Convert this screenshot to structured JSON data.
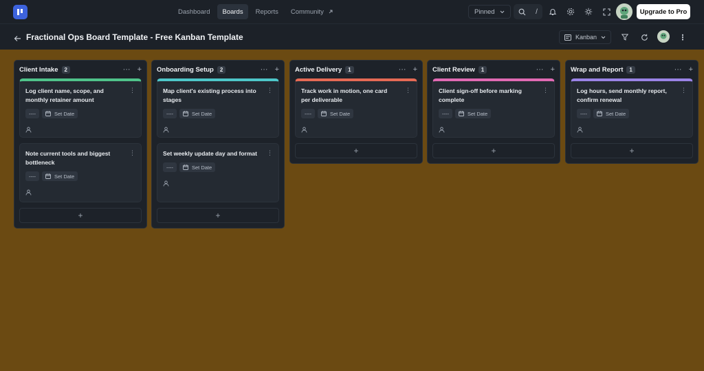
{
  "nav": {
    "items": [
      {
        "label": "Dashboard"
      },
      {
        "label": "Boards"
      },
      {
        "label": "Reports"
      },
      {
        "label": "Community"
      }
    ],
    "pinned_label": "Pinned",
    "search_shortcut": "/",
    "upgrade_label": "Upgrade to Pro"
  },
  "board": {
    "title": "Fractional Ops Board Template - Free Kanban Template",
    "view_label": "Kanban"
  },
  "columns": [
    {
      "title": "Client Intake",
      "count": "2",
      "accent": "#4fc38a",
      "cards": [
        {
          "title": "Log client name, scope, and monthly retainer amount",
          "priority": "----",
          "date_label": "Set Date"
        },
        {
          "title": "Note current tools and biggest bottleneck",
          "priority": "----",
          "date_label": "Set Date"
        }
      ]
    },
    {
      "title": "Onboarding Setup",
      "count": "2",
      "accent": "#4ec6c9",
      "cards": [
        {
          "title": "Map client's existing process into stages",
          "priority": "----",
          "date_label": "Set Date"
        },
        {
          "title": "Set weekly update day and format",
          "priority": "----",
          "date_label": "Set Date"
        }
      ]
    },
    {
      "title": "Active Delivery",
      "count": "1",
      "accent": "#e56a55",
      "cards": [
        {
          "title": "Track work in motion, one card per deliverable",
          "priority": "----",
          "date_label": "Set Date"
        }
      ]
    },
    {
      "title": "Client Review",
      "count": "1",
      "accent": "#e06ab3",
      "cards": [
        {
          "title": "Client sign-off before marking complete",
          "priority": "----",
          "date_label": "Set Date"
        }
      ]
    },
    {
      "title": "Wrap and Report",
      "count": "1",
      "accent": "#9a83e6",
      "cards": [
        {
          "title": "Log hours, send monthly report, confirm renewal",
          "priority": "----",
          "date_label": "Set Date"
        }
      ]
    }
  ],
  "colors": {
    "background": "#6b4a12",
    "panel": "#1c2128",
    "logo": "#3d63dd"
  }
}
